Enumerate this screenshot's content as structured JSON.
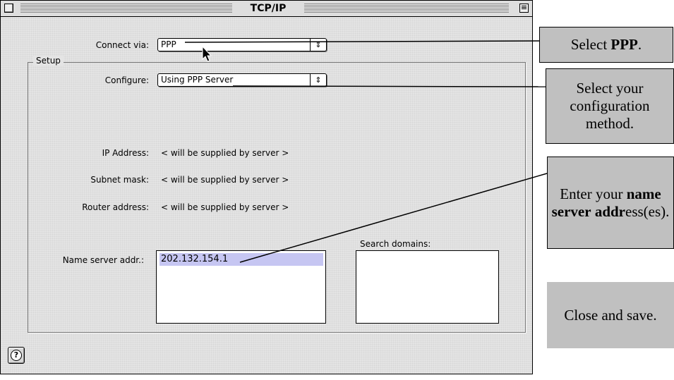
{
  "window": {
    "title": "TCP/IP"
  },
  "connect_via": {
    "label": "Connect via:",
    "value": "PPP"
  },
  "setup": {
    "group_label": "Setup",
    "configure_label": "Configure:",
    "configure_value": "Using PPP Server",
    "ip_address_label": "IP Address:",
    "ip_address_value": "< will be supplied by server >",
    "subnet_mask_label": "Subnet mask:",
    "subnet_mask_value": "< will be supplied by server >",
    "router_address_label": "Router address:",
    "router_address_value": "< will be supplied by server >",
    "name_server_label": "Name server addr.:",
    "name_server_value": "202.132.154.1",
    "search_domains_label": "Search domains:"
  },
  "help_icon": "question-mark-icon",
  "callouts": {
    "select_ppp": {
      "prefix": "Select ",
      "bold": "PPP",
      "suffix": "."
    },
    "select_config": {
      "text": "Select your configuration method."
    },
    "name_server": {
      "prefix": "Enter your ",
      "bold1": "name server",
      "bold2": "addr",
      "suffix": "ess(es)."
    },
    "close_save": {
      "text": "Close and save."
    }
  },
  "colors": {
    "callout_bg": "#c0c0c0",
    "selection": "#c6c6f2",
    "window_bg": "#e4e4e4"
  }
}
